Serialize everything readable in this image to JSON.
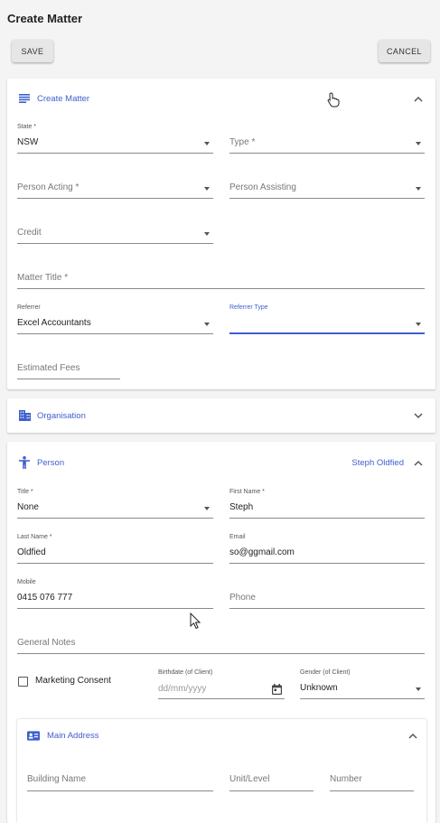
{
  "page": {
    "title": "Create Matter"
  },
  "toolbar": {
    "save_label": "SAVE",
    "cancel_label": "CANCEL"
  },
  "matter_panel": {
    "title": "Create Matter",
    "state": {
      "label": "State *",
      "value": "NSW"
    },
    "type": {
      "placeholder": "Type *"
    },
    "person_acting": {
      "placeholder": "Person Acting *"
    },
    "person_assisting": {
      "placeholder": "Person Assisting"
    },
    "credit": {
      "placeholder": "Credit"
    },
    "matter_title": {
      "placeholder": "Matter Title *"
    },
    "referrer": {
      "label": "Referrer",
      "value": "Excel Accountants"
    },
    "referrer_type": {
      "label": "Referrer Type",
      "value": ""
    },
    "estimated_fees": {
      "placeholder": "Estimated Fees"
    }
  },
  "organisation_panel": {
    "title": "Organisation"
  },
  "person_panel": {
    "title": "Person",
    "person_name": "Steph Oldfied",
    "title_field": {
      "label": "Title *",
      "value": "None"
    },
    "first_name": {
      "label": "First Name *",
      "value": "Steph"
    },
    "last_name": {
      "label": "Last Name *",
      "value": "Oldfied"
    },
    "email": {
      "label": "Email",
      "value": "so@ggmail.com"
    },
    "mobile": {
      "label": "Mobile",
      "value": "0415 076 777"
    },
    "phone": {
      "placeholder": "Phone"
    },
    "general_notes": {
      "placeholder": "General Notes"
    },
    "marketing_consent": {
      "label": "Marketing Consent",
      "checked": false
    },
    "birthdate": {
      "label": "Birthdate (of Client)",
      "placeholder": "dd/mm/yyyy"
    },
    "gender": {
      "label": "Gender (of Client)",
      "value": "Unknown"
    }
  },
  "address_panel": {
    "title": "Main Address",
    "building_name": {
      "placeholder": "Building Name"
    },
    "unit_level": {
      "placeholder": "Unit/Level"
    },
    "number": {
      "placeholder": "Number"
    }
  },
  "colors": {
    "accent": "#3f5fcf",
    "focus_line": "#3f5fcf"
  },
  "icons": [
    "notes-icon",
    "building-icon",
    "person-icon",
    "address-card-icon",
    "calendar-icon",
    "chevron-up-icon",
    "chevron-down-icon",
    "hand-pointer-icon",
    "arrow-pointer-icon"
  ]
}
